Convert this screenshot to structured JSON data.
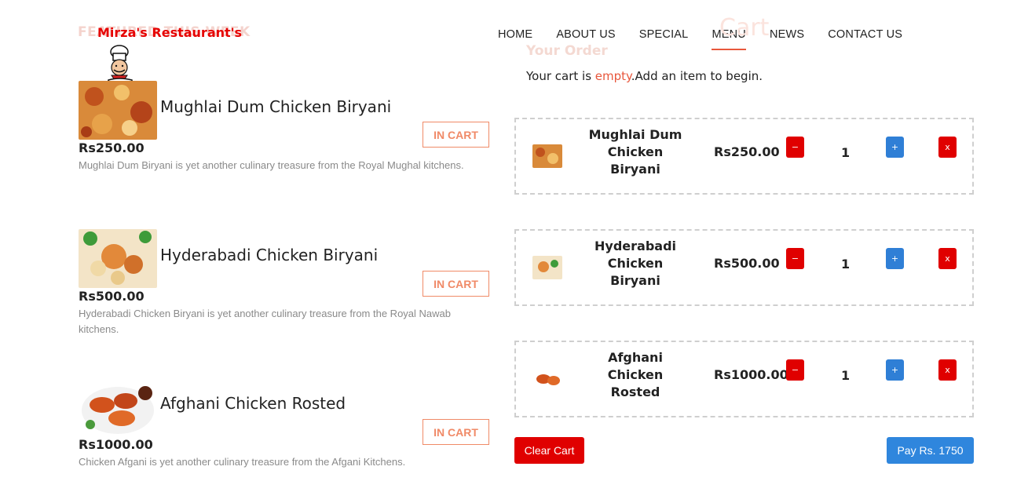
{
  "brand": {
    "logo_text": "Mirza's Restaurant's",
    "faded_heading": "FEATURED THIS WEEK"
  },
  "nav": {
    "items": [
      {
        "label": "HOME"
      },
      {
        "label": "ABOUT US"
      },
      {
        "label": "SPECIAL"
      },
      {
        "label": "MENU",
        "active": true
      },
      {
        "label": "NEWS"
      },
      {
        "label": "CONTACT US"
      }
    ]
  },
  "menu": {
    "items": [
      {
        "title": "Mughlai Dum Chicken Biryani",
        "price": "Rs250.00",
        "desc": "Mughlai Dum Biryani is yet another culinary treasure from the Royal Mughal kitchens.",
        "button": "IN CART"
      },
      {
        "title": "Hyderabadi Chicken Biryani",
        "price": "Rs500.00",
        "desc": "Hyderabadi Chicken Biryani is yet another culinary treasure from the Royal Nawab kitchens.",
        "button": "IN CART"
      },
      {
        "title": "Afghani Chicken Rosted",
        "price": "Rs1000.00",
        "desc": "Chicken Afgani is yet another culinary treasure from the Afgani Kitchens.",
        "button": "IN CART"
      }
    ]
  },
  "cart": {
    "heading": "Cart",
    "subheading": "Your Order",
    "msg_pre": "Your cart is ",
    "msg_hl": "empty",
    "msg_post": ".Add an item to begin.",
    "rows": [
      {
        "name_lines": [
          "Mughlai Dum",
          "Chicken",
          "Biryani"
        ],
        "price": "Rs250.00",
        "qty": "1"
      },
      {
        "name_lines": [
          "Hyderabadi",
          "Chicken",
          "Biryani"
        ],
        "price": "Rs500.00",
        "qty": "1"
      },
      {
        "name_lines": [
          "Afghani",
          "Chicken",
          "Rosted"
        ],
        "price": "Rs1000.00",
        "qty": "1"
      }
    ],
    "minus_label": "−",
    "plus_label": "+",
    "remove_label": "x",
    "clear_label": "Clear Cart",
    "pay_label": "Pay Rs. 1750"
  },
  "colors": {
    "accent": "#e8573c",
    "red": "#e00000",
    "blue": "#2f86dd"
  }
}
